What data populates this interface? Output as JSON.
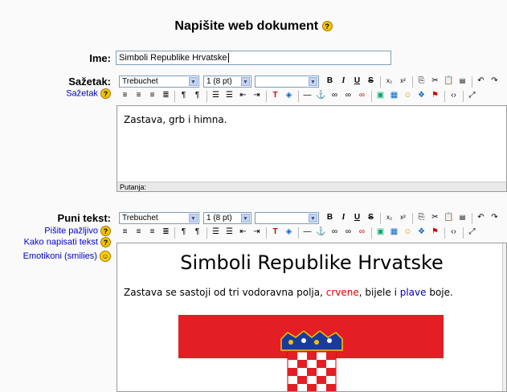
{
  "page": {
    "title": "Napišite web dokument",
    "title_help": "?"
  },
  "name_field": {
    "label": "Ime:",
    "value": "Simboli Republike Hrvatske"
  },
  "summary": {
    "label": "Sažetak:",
    "help_link": "Sažetak",
    "content": "Zastava, grb i himna.",
    "path_label": "Putanja:"
  },
  "fulltext": {
    "label": "Puni tekst:",
    "help_links": [
      "Pišite pažljivo",
      "Kako napisati tekst",
      "Emotikoni (smilies)"
    ],
    "heading": "Simboli Republike Hrvatske",
    "para_1": "Zastava se sastoji od tri vodoravna polja, ",
    "word_red": "crvene",
    "para_2": ", bijele i ",
    "word_blue": "plave",
    "para_3": " boje."
  },
  "toolbar": {
    "font": "Trebuchet",
    "size": "1 (8 pt)",
    "format": "",
    "buttons": [
      "B",
      "I",
      "U",
      "S"
    ]
  },
  "colors": {
    "flag_red": "#e31e24",
    "flag_blue": "#1a3b9c",
    "link": "#0000cc",
    "help_icon": "#f3c400"
  },
  "icons": [
    "help-icon",
    "smiley-icon",
    "dropdown-arrow-icon",
    "subscript-icon",
    "superscript-icon",
    "copy-icon",
    "cut-icon",
    "paste-icon",
    "undo-icon",
    "align-left-icon",
    "align-center-icon",
    "align-right-icon",
    "justify-icon",
    "ordered-list-icon",
    "unordered-list-icon",
    "outdent-icon",
    "indent-icon",
    "text-color-icon",
    "background-color-icon",
    "horizontal-rule-icon",
    "anchor-icon",
    "link-icon",
    "unlink-icon",
    "image-icon",
    "table-icon",
    "insert-smiley-icon",
    "special-char-icon",
    "source-code-icon",
    "fullscreen-icon"
  ]
}
